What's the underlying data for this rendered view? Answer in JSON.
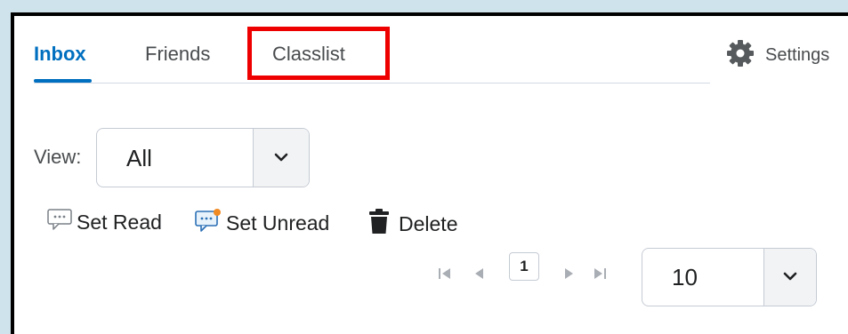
{
  "tabs": [
    {
      "label": "Inbox",
      "active": true
    },
    {
      "label": "Friends",
      "active": false
    },
    {
      "label": "Classlist",
      "active": false
    }
  ],
  "settings": {
    "label": "Settings",
    "icon": "gear-icon"
  },
  "view": {
    "label": "View:",
    "selected": "All"
  },
  "actions": {
    "set_read": "Set Read",
    "set_unread": "Set Unread",
    "delete": "Delete"
  },
  "pagination": {
    "current_page": "1",
    "page_size": "10"
  },
  "colors": {
    "accent": "#006fbf",
    "highlight": "#ee0000",
    "text": "#494c4e",
    "unread_dot": "#f08a24"
  }
}
